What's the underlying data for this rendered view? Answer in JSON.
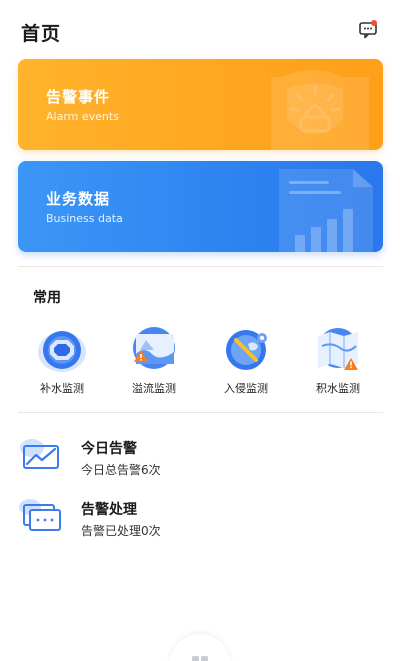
{
  "header": {
    "title": "首页",
    "message_icon": "message-icon"
  },
  "banners": [
    {
      "title": "告警事件",
      "subtitle": "Alarm events",
      "icon": "alarm-light-shield-icon",
      "color": "#ffa61e"
    },
    {
      "title": "业务数据",
      "subtitle": "Business data",
      "icon": "data-document-chart-icon",
      "color": "#2d83f0"
    }
  ],
  "quick": {
    "title": "常用",
    "items": [
      {
        "label": "补水监测",
        "icon": "water-supply-icon"
      },
      {
        "label": "溢流监测",
        "icon": "overflow-icon"
      },
      {
        "label": "入侵监测",
        "icon": "intrusion-icon"
      },
      {
        "label": "积水监测",
        "icon": "waterlogging-icon"
      }
    ]
  },
  "stats": [
    {
      "title": "今日告警",
      "desc": "今日总告警6次",
      "icon": "trend-chart-icon"
    },
    {
      "title": "告警处理",
      "desc": "告警已处理0次",
      "icon": "processing-card-icon"
    }
  ],
  "colors": {
    "alarm": "#ffa61e",
    "business": "#2d83f0",
    "icon_blue": "#3a7bf0",
    "warning": "#ff7a1a"
  },
  "tab_icon": "home-tab-icon"
}
